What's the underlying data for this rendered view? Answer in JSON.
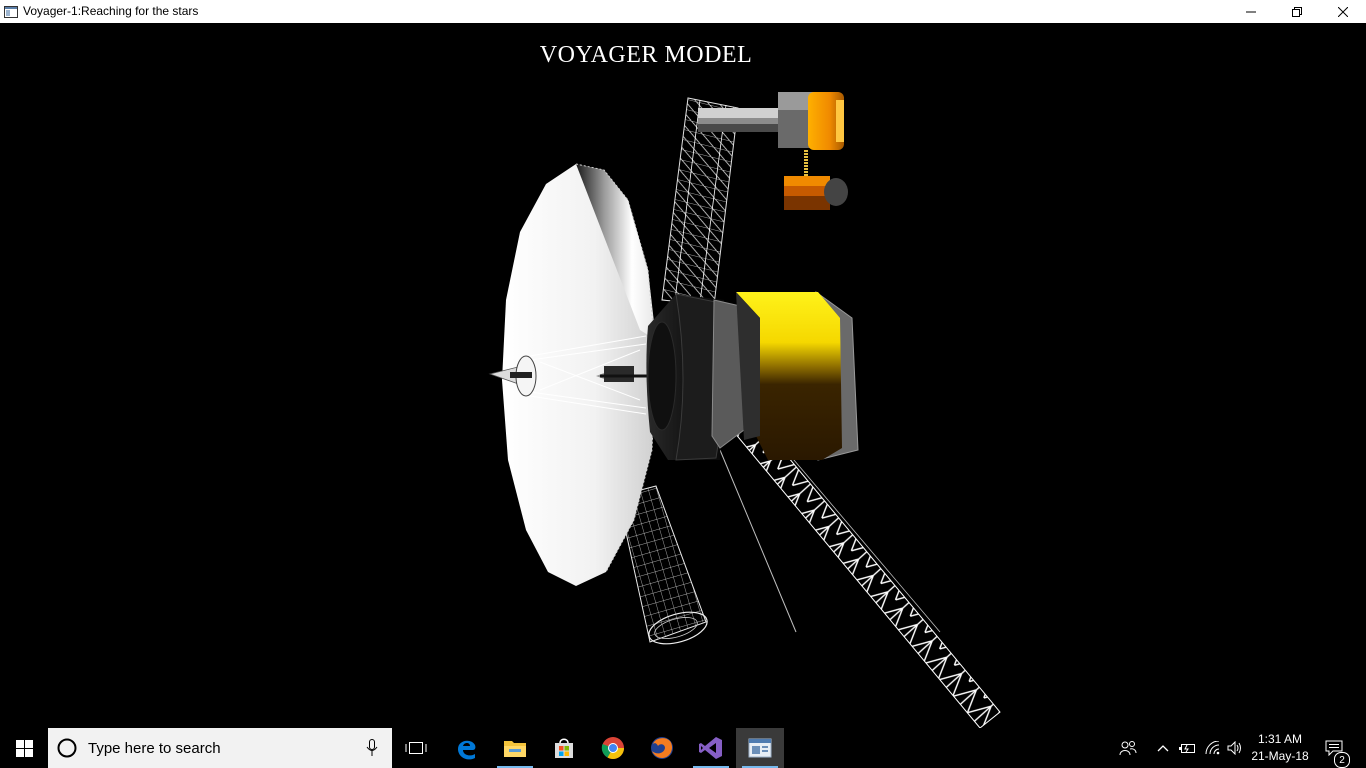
{
  "window": {
    "title": "Voyager-1:Reaching for the stars",
    "icon": "app-window-icon",
    "controls": [
      "minimize-icon",
      "restore-icon",
      "close-icon"
    ]
  },
  "viewport": {
    "model_title": "VOYAGER MODEL",
    "background": "#000000"
  },
  "taskbar": {
    "search_placeholder": "Type here to search",
    "pinned_apps": [
      "task-view-icon",
      "edge-icon",
      "file-explorer-icon",
      "store-icon",
      "chrome-icon",
      "firefox-icon",
      "visual-studio-icon",
      "voyager-app-icon"
    ],
    "tray_icons": [
      "people-icon",
      "show-hidden-icons-chevron",
      "battery-icon",
      "wifi-icon",
      "volume-icon"
    ],
    "clock_time": "1:31 AM",
    "clock_date": "21-May-18",
    "notification_count": "2"
  },
  "colors": {
    "accent": "#76b9ed",
    "edge_blue": "#0078d7",
    "folder_yellow": "#f3c33b",
    "vs_purple": "#865fc5",
    "dish_white": "#ffffff",
    "rtg_yellow": "#ffe500",
    "instrument_orange": "#f08a00"
  }
}
